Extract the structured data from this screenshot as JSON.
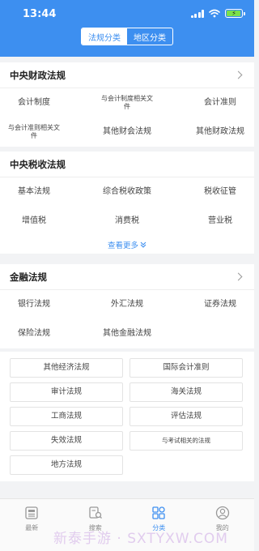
{
  "status": {
    "time": "13:44"
  },
  "segment": {
    "tab1": "法规分类",
    "tab2": "地区分类"
  },
  "sections": {
    "s1": {
      "title": "中央财政法规",
      "items": [
        "会计制度",
        "与会计制度相关文件",
        "会计准则",
        "与会计准则相关文件",
        "其他财会法规",
        "其他财政法规"
      ]
    },
    "s2": {
      "title": "中央税收法规",
      "items": [
        "基本法规",
        "综合税收政策",
        "税收征管",
        "增值税",
        "消费税",
        "营业税"
      ],
      "more": "查看更多"
    },
    "s3": {
      "title": "金融法规",
      "items": [
        "银行法规",
        "外汇法规",
        "证券法规",
        "保险法规",
        "其他金融法规"
      ]
    },
    "s4": {
      "items": [
        "其他经济法规",
        "国际会计准则",
        "审计法规",
        "海关法规",
        "工商法规",
        "评估法规",
        "失效法规",
        "与考试相关的法规",
        "地方法规"
      ]
    }
  },
  "tabbar": {
    "tab1": "最新",
    "tab2": "搜索",
    "tab3": "分类",
    "tab4": "我的"
  },
  "watermark": "新泰手游 · SXTYXW.COM",
  "colors": {
    "primary": "#3d8ff0",
    "battery": "#7be04a"
  }
}
